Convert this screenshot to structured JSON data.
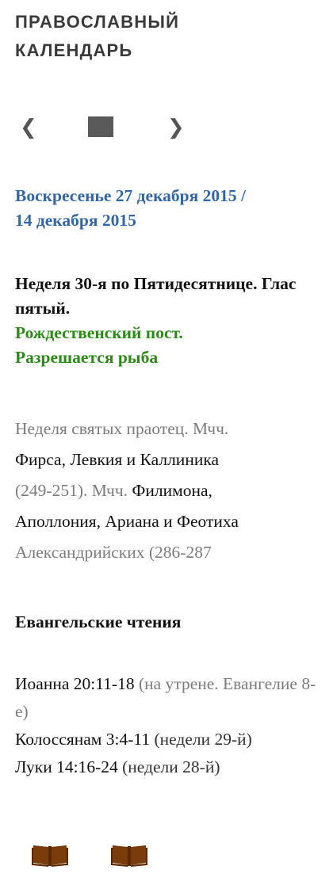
{
  "widget": {
    "title_line1": "ПРАВОСЛАВНЫЙ",
    "title_line2": "КАЛЕНДАРЬ"
  },
  "nav": {
    "prev_glyph": "❮",
    "next_glyph": "❯"
  },
  "day": {
    "date_new": "Воскресенье 27 декабря 2015 /",
    "date_old": "14 декабря 2015",
    "week_text": "Неделя 30-я по Пятидесятнице. Глас пятый.",
    "fast_line1": "Рождественский пост.",
    "fast_line2": "Разрешается рыба"
  },
  "saints": {
    "part1": "Неделя святых праотец. Мчч.",
    "part2": "Фирса, Левкия и Каллиника",
    "part3": "(249-251). Мчч.",
    "part4": "Филимона,",
    "part5": "Аполлония, Ариана и Феотиха",
    "part6": "Александрийских (286-287"
  },
  "readings": {
    "heading": "Евангельские чтения",
    "items": [
      {
        "ref": "Иоанна 20:11-18",
        "note": "(на утрене. Евангелие 8-е)"
      },
      {
        "ref": "Колоссянам 3:4-11",
        "note": "(недели 29-й)"
      },
      {
        "ref": "Луки 14:16-24",
        "note": "(недели 28-й)"
      }
    ]
  },
  "colors": {
    "date_blue": "#3366a8",
    "fast_green": "#2a8a16",
    "muted_grey": "#7b7b7b",
    "book_brown": "#7a3c0b"
  },
  "icons": {
    "prev": "chevron-left-icon",
    "today": "square-icon",
    "next": "chevron-right-icon",
    "book": "open-book-icon"
  }
}
